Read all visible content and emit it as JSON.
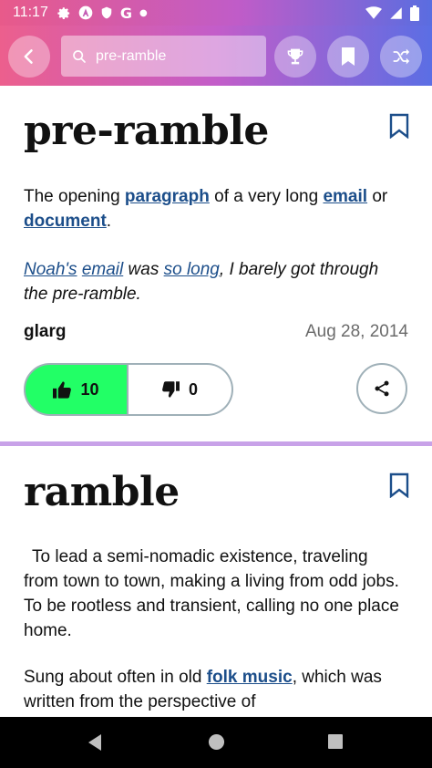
{
  "status_bar": {
    "time": "11:17"
  },
  "app_bar": {
    "search_value": "pre-ramble",
    "icons": [
      "back-arrow-icon",
      "search-icon",
      "trophy-icon",
      "bookmark-icon",
      "shuffle-icon"
    ]
  },
  "entries": [
    {
      "word": "pre-ramble",
      "definition": {
        "t1": "The opening ",
        "l1": "paragraph",
        "t2": " of a very long ",
        "l2": "email",
        "t3": " or ",
        "l3": "document",
        "t4": "."
      },
      "example": {
        "l1": "Noah's",
        "s1": " ",
        "l2": "email",
        "t1": " was ",
        "l3": "so long",
        "t2": ", I barely got through the pre-ramble."
      },
      "author": "glarg",
      "date": "Aug 28, 2014",
      "upvotes": "10",
      "downvotes": "0"
    },
    {
      "word": "ramble",
      "definition_p1": "To lead a semi-nomadic existence, traveling from town to town, making a living from odd jobs.  To be rootless and transient, calling no one place home.",
      "definition_p2_t1": "Sung about often in old ",
      "definition_p2_l1": "folk music",
      "definition_p2_t2": ", which was written from the perspective of"
    }
  ],
  "colors": {
    "link": "#1c4e8a",
    "upvote_bg": "#22ff66",
    "divider": "#c8a2e8",
    "gradient_start": "#ec5f8d",
    "gradient_end": "#5b6ee4"
  }
}
